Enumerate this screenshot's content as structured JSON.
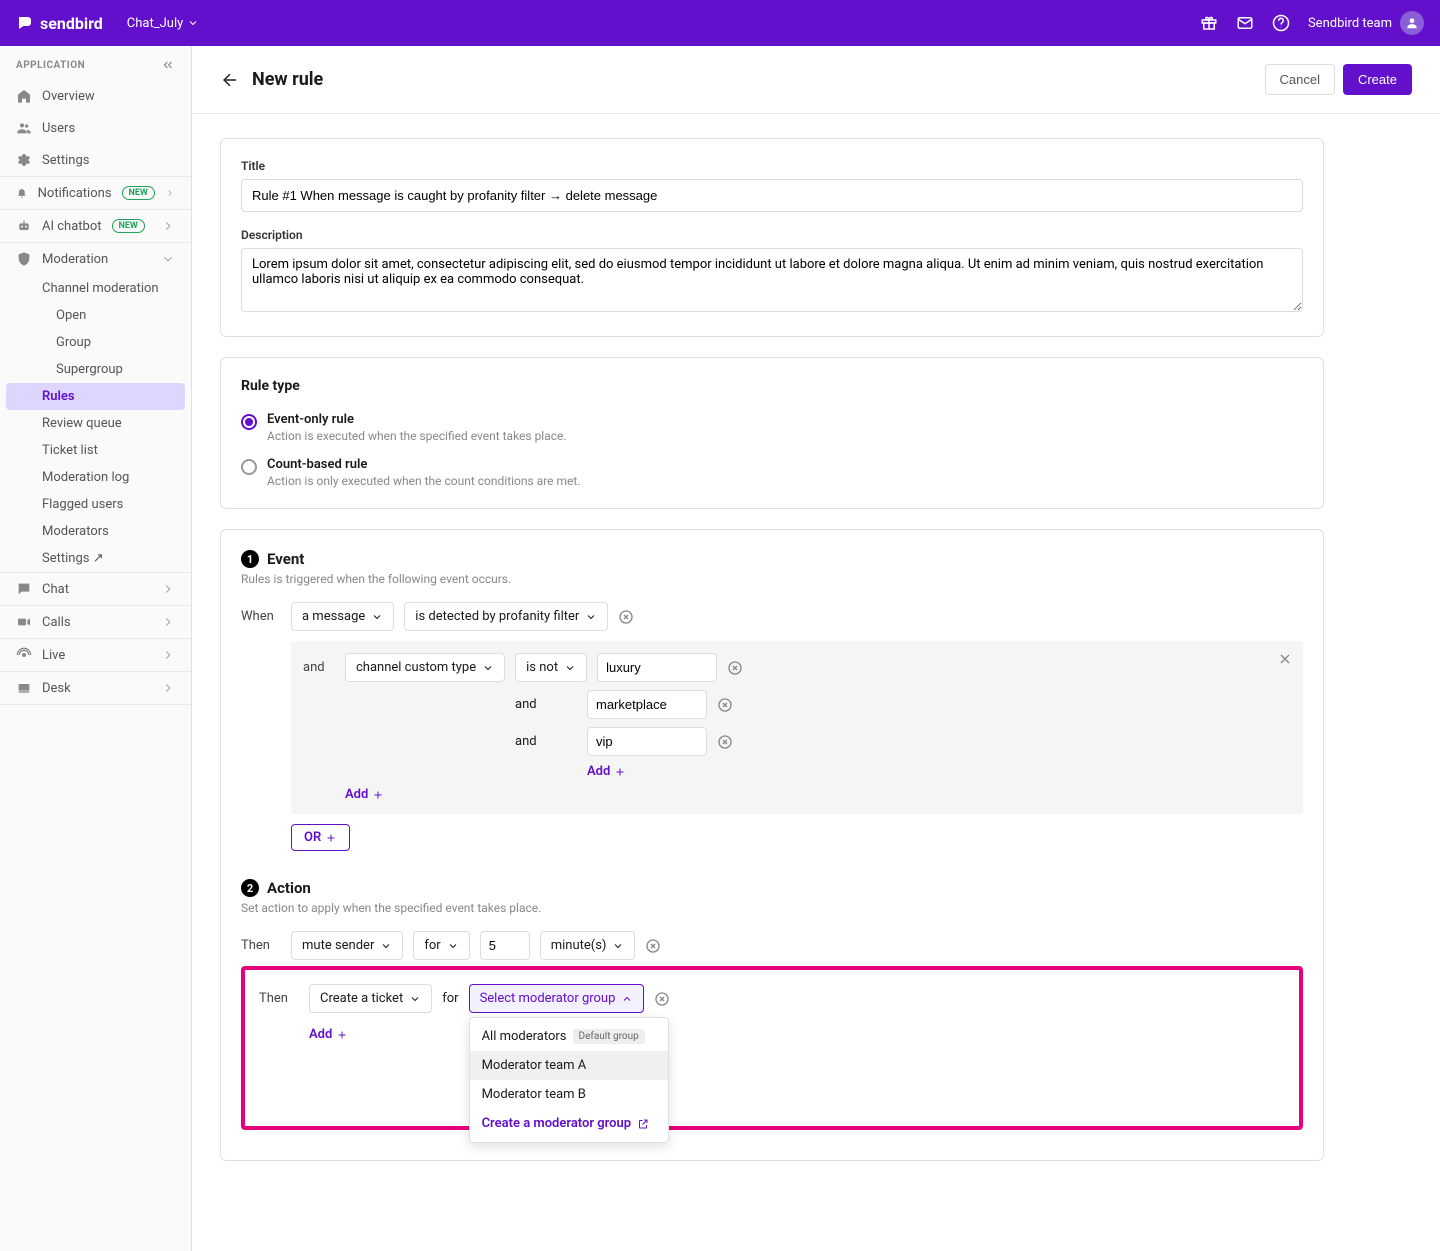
{
  "topbar": {
    "brand": "sendbird",
    "app_name": "Chat_July",
    "user_team": "Sendbird team"
  },
  "sidebar": {
    "section_label": "APPLICATION",
    "overview": "Overview",
    "users": "Users",
    "settings": "Settings",
    "notifications": "Notifications",
    "ai_chatbot": "AI chatbot",
    "new_badge": "NEW",
    "moderation": "Moderation",
    "mod_sub": {
      "channel": "Channel moderation",
      "open": "Open",
      "group": "Group",
      "supergroup": "Supergroup",
      "rules": "Rules",
      "review_queue": "Review queue",
      "ticket_list": "Ticket list",
      "moderation_log": "Moderation log",
      "flagged_users": "Flagged users",
      "moderators": "Moderators",
      "settings": "Settings ↗"
    },
    "chat": "Chat",
    "calls": "Calls",
    "live": "Live",
    "desk": "Desk"
  },
  "header": {
    "title": "New rule",
    "cancel": "Cancel",
    "create": "Create"
  },
  "form": {
    "title_label": "Title",
    "title_value": "Rule #1 When message is caught by profanity filter → delete message",
    "desc_label": "Description",
    "desc_value": "Lorem ipsum dolor sit amet, consectetur adipiscing elit, sed do eiusmod tempor incididunt ut labore et dolore magna aliqua. Ut enim ad minim veniam, quis nostrud exercitation ullamco laboris nisi ut aliquip ex ea commodo consequat."
  },
  "ruletype": {
    "section": "Rule type",
    "event_label": "Event-only rule",
    "event_desc": "Action is executed when the specified event takes place.",
    "count_label": "Count-based rule",
    "count_desc": "Action is only executed when the count conditions are met."
  },
  "event": {
    "num": "1",
    "title": "Event",
    "desc": "Rules is triggered when the following event occurs.",
    "when": "When",
    "subject": "a message",
    "predicate": "is detected by profanity filter",
    "and": "and",
    "cond_subject": "channel custom type",
    "cond_op": "is not",
    "val1": "luxury",
    "val2": "marketplace",
    "val3": "vip",
    "add": "Add",
    "or": "OR"
  },
  "action": {
    "num": "2",
    "title": "Action",
    "desc": "Set action to apply when the specified event takes place.",
    "then": "Then",
    "act1": "mute sender",
    "for": "for",
    "duration": "5",
    "unit": "minute(s)",
    "act2": "Create a ticket",
    "select_mod": "Select moderator group",
    "add": "Add"
  },
  "dropdown": {
    "all_mods": "All moderators",
    "default": "Default group",
    "team_a": "Moderator team A",
    "team_b": "Moderator team B",
    "create_link": "Create a moderator group"
  }
}
